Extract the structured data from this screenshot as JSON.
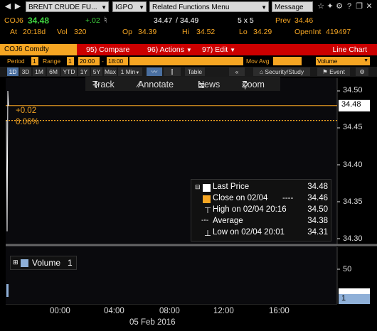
{
  "toolbar": {
    "security_dropdown": "BRENT CRUDE FU...",
    "function_dropdown": "IGPO",
    "related_dropdown": "Related Functions Menu",
    "message_label": "Message"
  },
  "quote": {
    "ticker": "COJ6",
    "last": "34.48",
    "change": "+.02",
    "bid": "34.47",
    "ask": "34.49",
    "size": "5 x 5",
    "prev_label": "Prev",
    "prev": "34.46",
    "time_label": "At",
    "time": "20:18d",
    "vol_label": "Vol",
    "vol": "320",
    "open_label": "Op",
    "open": "34.39",
    "high_label": "Hi",
    "high": "34.52",
    "low_label": "Lo",
    "low": "34.29",
    "openint_label": "OpenInt",
    "openint": "419497"
  },
  "menu_bar": {
    "security": "COJ6 Comdty",
    "compare": "Compare",
    "compare_num": "95",
    "actions": "Actions",
    "actions_num": "96",
    "edit": "Edit",
    "edit_num": "97",
    "chart_type": "Line Chart"
  },
  "settings": {
    "period_label": "Period",
    "period_value": "1",
    "range_label": "Range",
    "range_value": "1",
    "range_from": "20:00",
    "range_to": "18:00",
    "mov_avg_label": "Mov Avg",
    "study_value": "Volume"
  },
  "periods": [
    "1D",
    "3D",
    "1M",
    "6M",
    "YTD",
    "1Y",
    "5Y",
    "Max",
    "1 Min"
  ],
  "controls": {
    "table": "Table",
    "security_study": "Security/Study",
    "event": "Event"
  },
  "chart_tools": {
    "track": "Track",
    "annotate": "Annotate",
    "news": "News",
    "zoom": "Zoom"
  },
  "chart_data": {
    "type": "line",
    "yticks": [
      "34.50",
      "34.45",
      "34.40",
      "34.35",
      "34.30"
    ],
    "ylim": [
      34.3,
      34.5
    ],
    "last_value": "34.48",
    "last_change": "+0.02",
    "last_change_pct": "0.06%",
    "xticks": [
      "00:00",
      "04:00",
      "08:00",
      "12:00",
      "16:00"
    ],
    "date_label": "05 Feb 2016",
    "volume_yticks": [
      "50"
    ],
    "volume_last": "1",
    "volume_label": "Volume",
    "volume_value": "1"
  },
  "legend": {
    "last_price_label": "Last Price",
    "last_price_value": "34.48",
    "close_label": "Close on 02/04",
    "close_value": "34.46",
    "high_label": "High on 02/04 20:16",
    "high_value": "34.50",
    "average_label": "Average",
    "average_value": "34.38",
    "low_label": "Low on 02/04 20:01",
    "low_value": "34.31"
  },
  "colors": {
    "amber": "#f6a623",
    "red_bar": "#cc0000",
    "green": "#3fd33f"
  }
}
